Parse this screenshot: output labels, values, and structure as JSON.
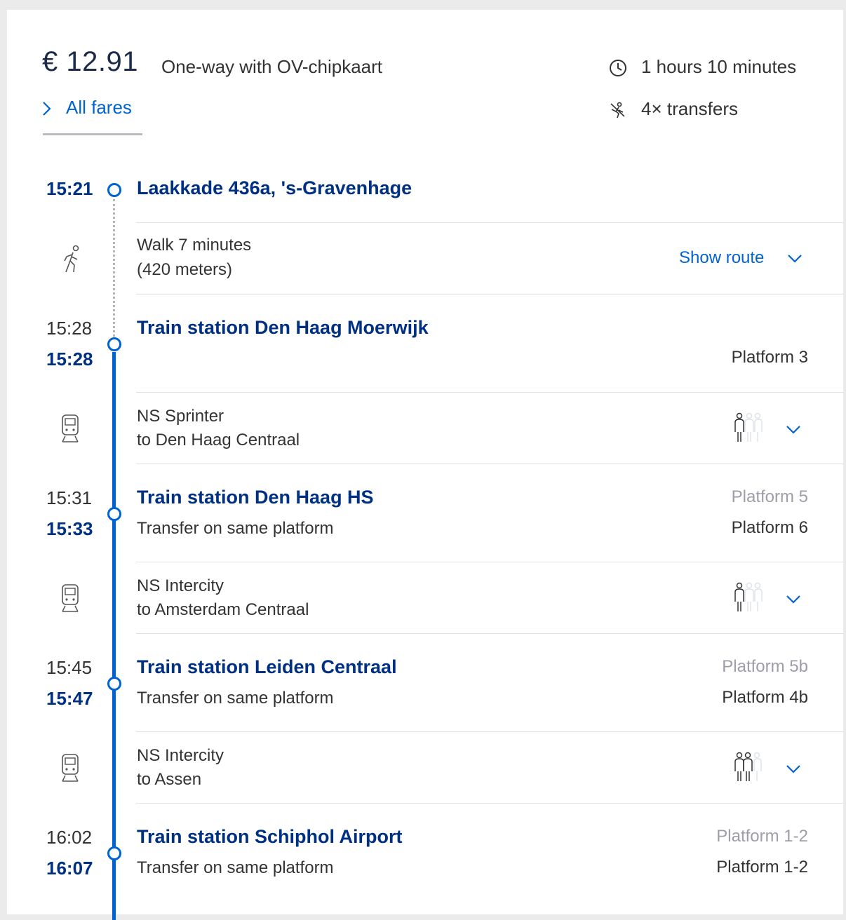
{
  "header": {
    "price": "€ 12.91",
    "price_label": "One-way with OV-chipkaart",
    "all_fares_label": "All fares",
    "duration": "1 hours 10 minutes",
    "transfers": "4× transfers"
  },
  "trip": {
    "origin": {
      "time": "15:21",
      "name": "Laakkade 436a, 's-Gravenhage"
    },
    "walk": {
      "line1": "Walk 7 minutes",
      "line2": "(420 meters)",
      "show_route_label": "Show route"
    },
    "stops": [
      {
        "arrival": "15:28",
        "departure": "15:28",
        "name": "Train station Den Haag Moerwijk",
        "note": "",
        "platform_arrival": "",
        "platform_departure": "Platform 3"
      },
      {
        "arrival": "15:31",
        "departure": "15:33",
        "name": "Train station Den Haag HS",
        "note": "Transfer on same platform",
        "platform_arrival": "Platform 5",
        "platform_departure": "Platform 6"
      },
      {
        "arrival": "15:45",
        "departure": "15:47",
        "name": "Train station Leiden Centraal",
        "note": "Transfer on same platform",
        "platform_arrival": "Platform 5b",
        "platform_departure": "Platform 4b"
      },
      {
        "arrival": "16:02",
        "departure": "16:07",
        "name": "Train station Schiphol Airport",
        "note": "Transfer on same platform",
        "platform_arrival": "Platform 1-2",
        "platform_departure": "Platform 1-2"
      }
    ],
    "legs": [
      {
        "service": "NS Sprinter",
        "direction": "to Den Haag Centraal",
        "crowd_icon": "crowd-low-icon"
      },
      {
        "service": "NS Intercity",
        "direction": "to Amsterdam Centraal",
        "crowd_icon": "crowd-low-icon"
      },
      {
        "service": "NS Intercity",
        "direction": "to Assen",
        "crowd_icon": "crowd-medium-icon"
      }
    ]
  },
  "colors": {
    "primary_blue": "#0063d3",
    "dark_blue": "#003082",
    "muted": "#9e9ea8"
  }
}
